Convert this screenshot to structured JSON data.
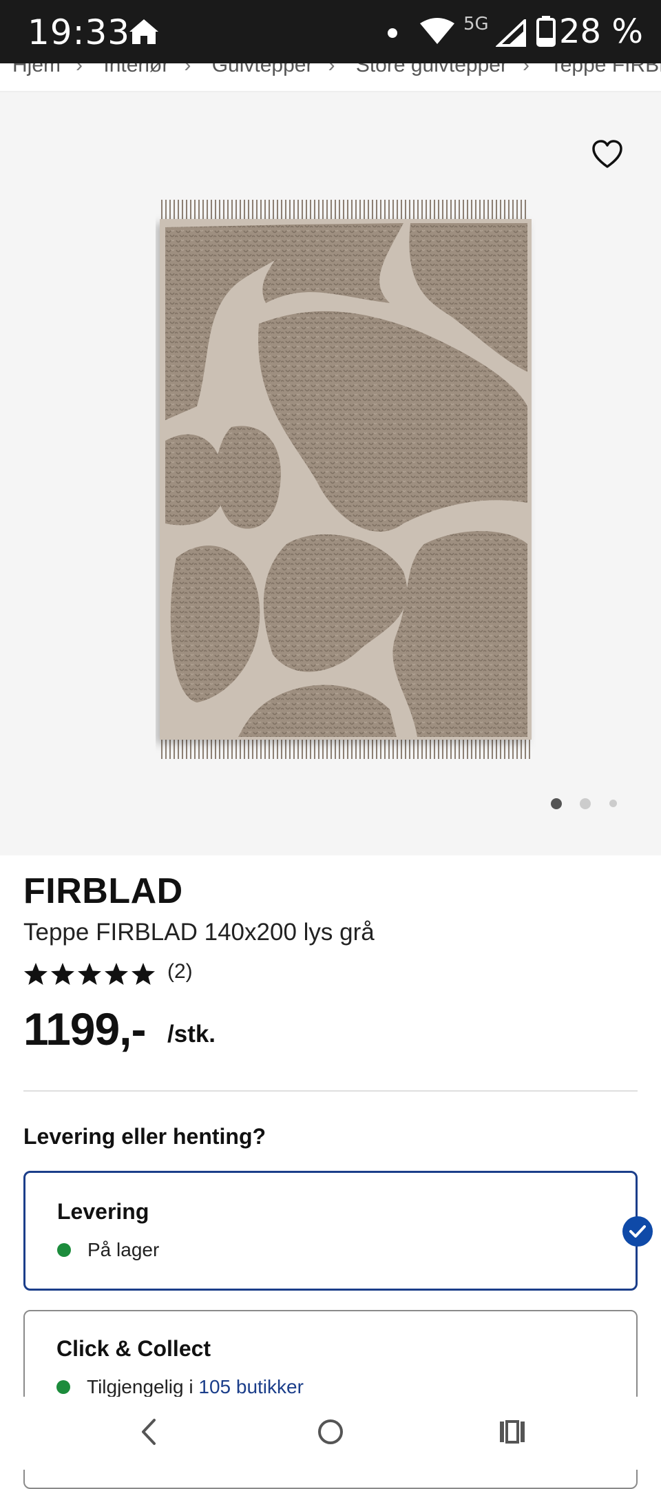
{
  "status_bar": {
    "time": "19:33",
    "network": "5G",
    "battery": "28 %"
  },
  "breadcrumb": [
    "Hjem",
    "Interiør",
    "Gulvtepper",
    "Store gulvtepper",
    "Teppe FIRBLAD"
  ],
  "gallery": {
    "image_count": 3,
    "active_index": 0,
    "favorite_icon": "heart-icon"
  },
  "product": {
    "name": "FIRBLAD",
    "description": "Teppe FIRBLAD 140x200 lys grå",
    "rating_stars": 5,
    "review_count": "(2)",
    "price": "1199,-",
    "unit": "/stk."
  },
  "fulfillment": {
    "question": "Levering eller henting?",
    "delivery": {
      "title": "Levering",
      "status": "På lager",
      "selected": true
    },
    "collect": {
      "title": "Click & Collect",
      "status_prefix": "Tilgjengelig i ",
      "status_link": "105 butikker"
    }
  },
  "colors": {
    "accent": "#1b3e8a",
    "in_stock": "#1c8c3c",
    "check": "#0f4aa8"
  },
  "nav": {
    "back": "back-icon",
    "home": "home-circle-icon",
    "recents": "recents-icon"
  }
}
